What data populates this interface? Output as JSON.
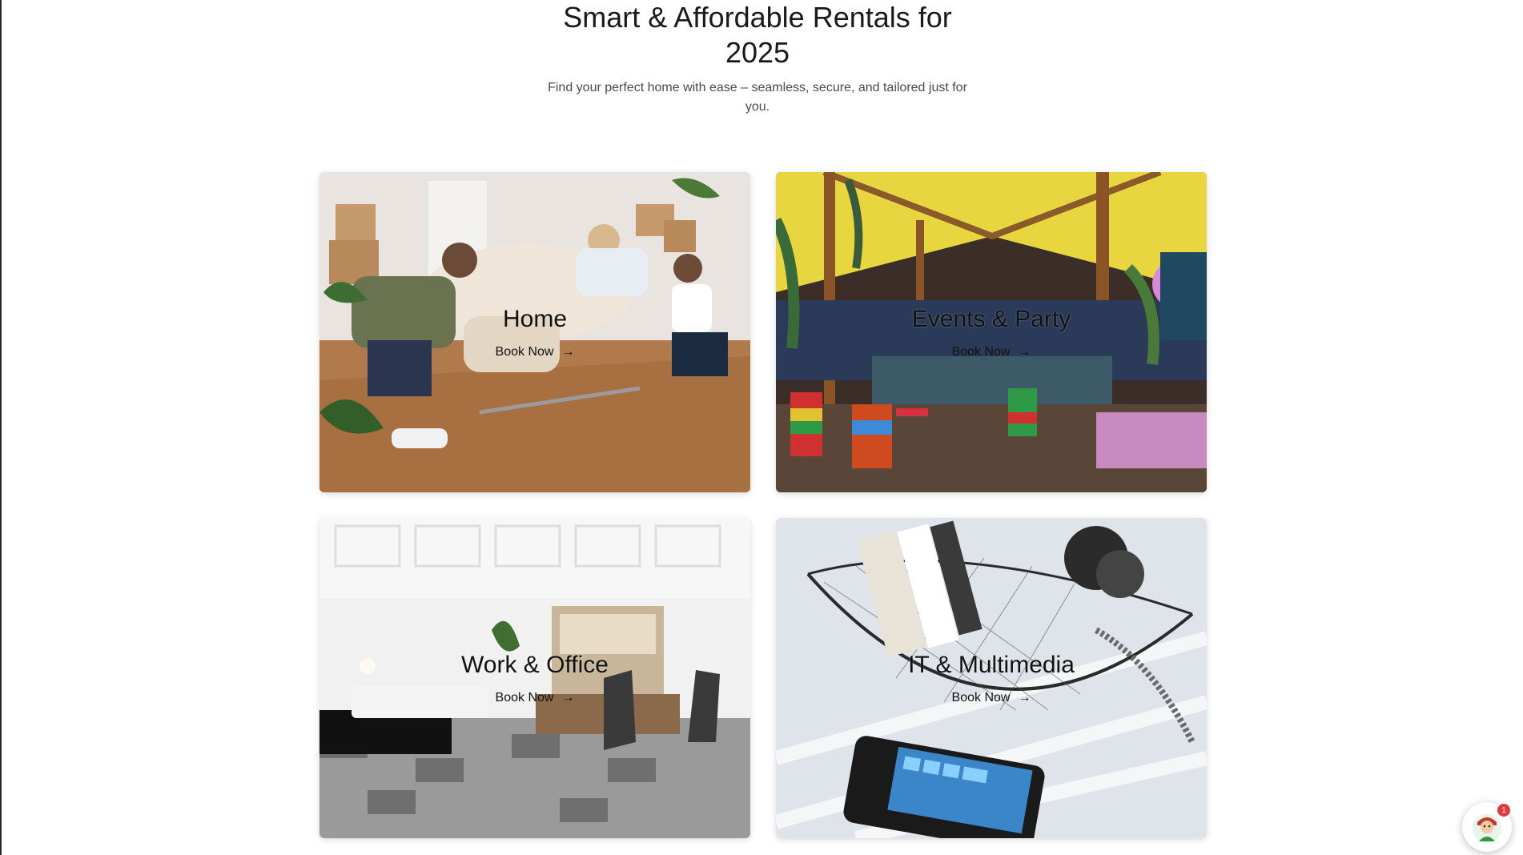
{
  "hero": {
    "title": "Smart & Affordable Rentals for 2025",
    "subtitle": "Find your perfect home with ease – seamless, secure, and tailored just for you."
  },
  "cards": [
    {
      "title": "Home",
      "cta": "Book Now",
      "arrow": "→",
      "icon": "arrow-right-icon"
    },
    {
      "title": "Events & Party",
      "cta": "Book Now",
      "arrow": "→",
      "icon": "arrow-right-icon"
    },
    {
      "title": "Work & Office",
      "cta": "Book Now",
      "arrow": "→",
      "icon": "arrow-right-icon"
    },
    {
      "title": "IT & Multimedia",
      "cta": "Book Now",
      "arrow": "→",
      "icon": "arrow-right-icon"
    }
  ],
  "chat": {
    "badge": "1",
    "icon": "assistant-avatar-icon"
  },
  "colors": {
    "accent_badge": "#e03a3a",
    "text": "#1a1a1a",
    "muted": "#4a4a4a"
  }
}
